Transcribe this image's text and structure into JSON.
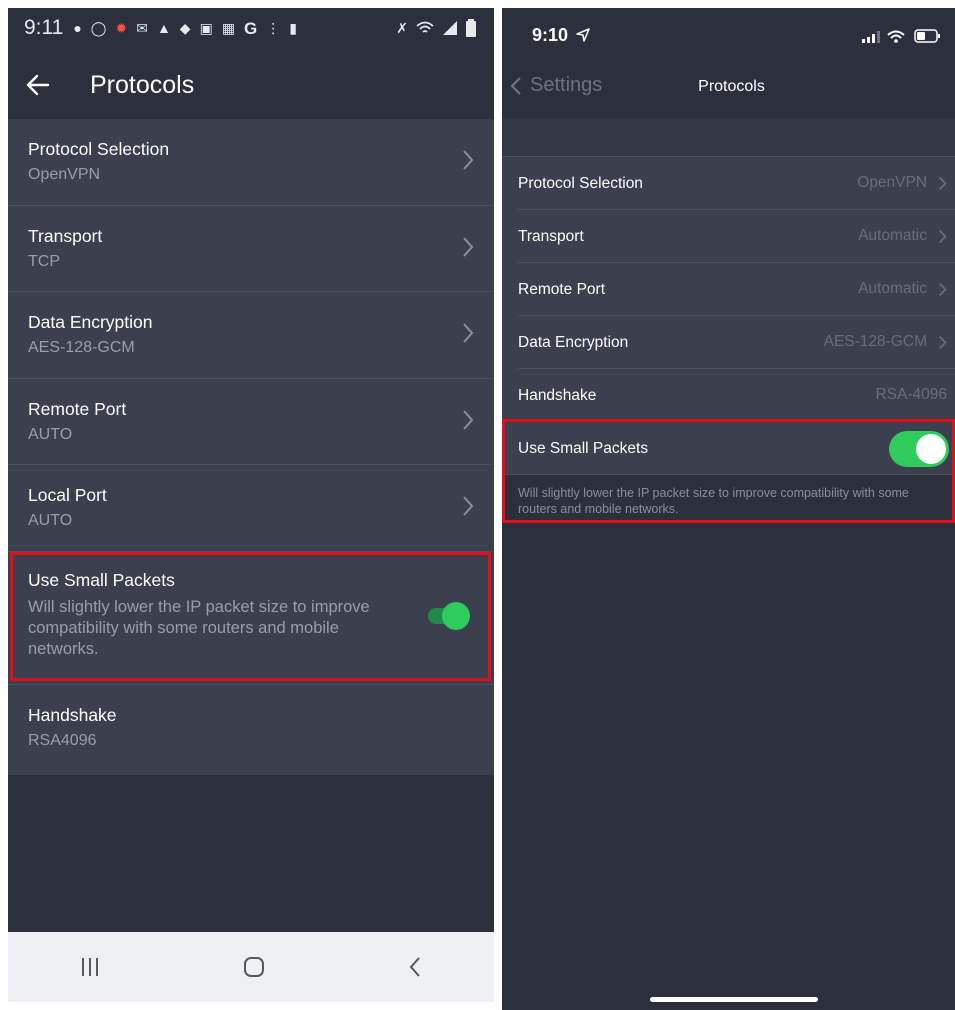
{
  "android": {
    "status_time": "9:11",
    "title": "Protocols",
    "rows": [
      {
        "label": "Protocol Selection",
        "value": "OpenVPN"
      },
      {
        "label": "Transport",
        "value": "TCP"
      },
      {
        "label": "Data Encryption",
        "value": "AES-128-GCM"
      },
      {
        "label": "Remote Port",
        "value": "AUTO"
      },
      {
        "label": "Local Port",
        "value": "AUTO"
      }
    ],
    "small_packets": {
      "label": "Use Small Packets",
      "description": "Will slightly lower the IP packet size to improve compatibility with some routers and mobile networks.",
      "enabled": true
    },
    "handshake": {
      "label": "Handshake",
      "value": "RSA4096"
    },
    "icons": {
      "back": "back-arrow-icon",
      "chevron": "chevron-right-icon",
      "nav_recent": "recent-apps-icon",
      "nav_home": "home-icon",
      "nav_back": "nav-back-icon"
    }
  },
  "ios": {
    "status_time": "9:10",
    "back_label": "Settings",
    "title": "Protocols",
    "rows": [
      {
        "label": "Protocol Selection",
        "value": "OpenVPN"
      },
      {
        "label": "Transport",
        "value": "Automatic"
      },
      {
        "label": "Remote Port",
        "value": "Automatic"
      },
      {
        "label": "Data Encryption",
        "value": "AES-128-GCM"
      }
    ],
    "handshake": {
      "label": "Handshake",
      "value": "RSA-4096"
    },
    "small_packets": {
      "label": "Use Small Packets",
      "description": "Will slightly lower the IP packet size to improve compatibility with some routers and mobile networks.",
      "enabled": true
    }
  },
  "colors": {
    "background": "#2c303c",
    "row_background": "#3b3f4e",
    "toggle_on": "#2ecb5e",
    "highlight": "#e0101a"
  }
}
